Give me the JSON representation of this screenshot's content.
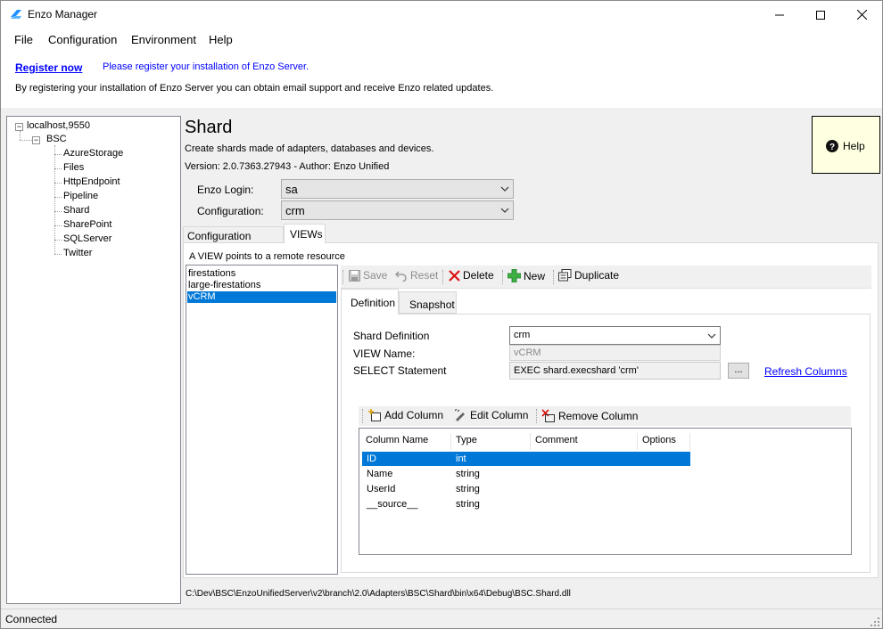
{
  "window": {
    "title": "Enzo Manager"
  },
  "menu": {
    "file": "File",
    "configuration": "Configuration",
    "environment": "Environment",
    "help": "Help"
  },
  "registration": {
    "link": "Register now",
    "message": "Please register your installation of Enzo Server.",
    "description": "By registering your installation of Enzo Server you can obtain email support and receive Enzo related updates."
  },
  "tree": {
    "root": "localhost,9550",
    "group": "BSC",
    "items": [
      "AzureStorage",
      "Files",
      "HttpEndpoint",
      "Pipeline",
      "Shard",
      "SharePoint",
      "SQLServer",
      "Twitter"
    ]
  },
  "header": {
    "title": "Shard",
    "subtitle": "Create shards made of adapters, databases and devices.",
    "version": "Version: 2.0.7363.27943 - Author: Enzo Unified"
  },
  "help": {
    "label": "Help"
  },
  "form": {
    "login_label": "Enzo Login:",
    "login_value": "sa",
    "config_label": "Configuration:",
    "config_value": "crm"
  },
  "tabs": {
    "config_settings": "Configuration Settings",
    "views": "VIEWs"
  },
  "views": {
    "description": "A VIEW points to a remote resource",
    "items": [
      "firestations",
      "large-firestations",
      "vCRM"
    ]
  },
  "toolbar": {
    "save": "Save",
    "reset": "Reset",
    "delete": "Delete",
    "new": "New",
    "duplicate": "Duplicate"
  },
  "subtabs": {
    "definition": "Definition",
    "snapshot": "Snapshot"
  },
  "definition": {
    "shard_def_label": "Shard Definition",
    "shard_def_value": "crm",
    "view_name_label": "VIEW Name:",
    "view_name_value": "vCRM",
    "select_label": "SELECT Statement",
    "select_value": "EXEC shard.execshard 'crm'",
    "browse_label": "...",
    "refresh_link": "Refresh Columns"
  },
  "grid_toolbar": {
    "add": "Add Column",
    "edit": "Edit Column",
    "remove": "Remove Column"
  },
  "columns": {
    "headers": [
      "Column Name",
      "Type",
      "Comment",
      "Options"
    ],
    "rows": [
      {
        "name": "ID",
        "type": "int"
      },
      {
        "name": "Name",
        "type": "string"
      },
      {
        "name": "UserId",
        "type": "string"
      },
      {
        "name": "__source__",
        "type": "string"
      }
    ]
  },
  "path": "C:\\Dev\\BSC\\EnzoUnifiedServer\\v2\\branch\\2.0\\Adapters\\BSC\\Shard\\bin\\x64\\Debug\\BSC.Shard.dll",
  "status": {
    "text": "Connected"
  },
  "colors": {
    "selection": "#0078d7",
    "link": "#0000ff",
    "help_bg": "#ffffe1"
  }
}
